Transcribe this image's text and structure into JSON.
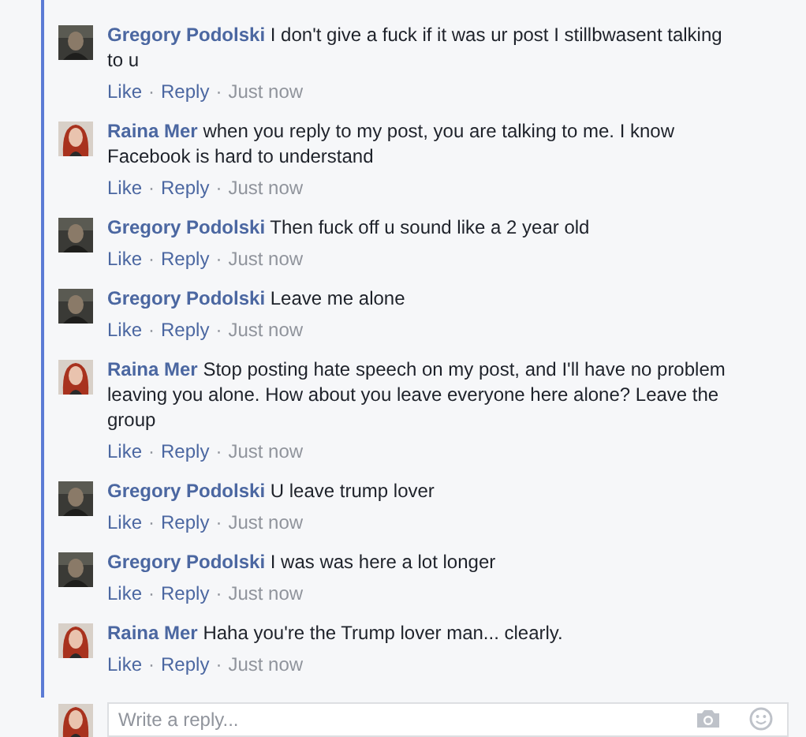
{
  "comments": [
    {
      "author": "Gregory Podolski",
      "text": "I don't give a fuck if it was ur post I stillbwasent talking to u",
      "like": "Like",
      "sep1": "·",
      "reply": "Reply",
      "sep2": "·",
      "time": "Just now"
    },
    {
      "author": "Raina Mer",
      "text": "when you reply to my post, you are talking to me. I know Facebook is hard to understand",
      "like": "Like",
      "sep1": "·",
      "reply": "Reply",
      "sep2": "·",
      "time": "Just now"
    },
    {
      "author": "Gregory Podolski",
      "text": "Then fuck off u sound like a 2 year old",
      "like": "Like",
      "sep1": "·",
      "reply": "Reply",
      "sep2": "·",
      "time": "Just now"
    },
    {
      "author": "Gregory Podolski",
      "text": "Leave me alone",
      "like": "Like",
      "sep1": "·",
      "reply": "Reply",
      "sep2": "·",
      "time": "Just now"
    },
    {
      "author": "Raina Mer",
      "text": "Stop posting hate speech on my post, and I'll have no problem leaving you alone. How about you leave everyone here alone? Leave the group",
      "like": "Like",
      "sep1": "·",
      "reply": "Reply",
      "sep2": "·",
      "time": "Just now"
    },
    {
      "author": "Gregory Podolski",
      "text": "U leave trump lover",
      "like": "Like",
      "sep1": "·",
      "reply": "Reply",
      "sep2": "·",
      "time": "Just now"
    },
    {
      "author": "Gregory Podolski",
      "text": "I was was here a lot longer",
      "like": "Like",
      "sep1": "·",
      "reply": "Reply",
      "sep2": "·",
      "time": "Just now"
    },
    {
      "author": "Raina Mer",
      "text": "Haha you're the Trump lover man... clearly.",
      "like": "Like",
      "sep1": "·",
      "reply": "Reply",
      "sep2": "·",
      "time": "Just now"
    }
  ],
  "reply_box": {
    "placeholder": "Write a reply..."
  }
}
